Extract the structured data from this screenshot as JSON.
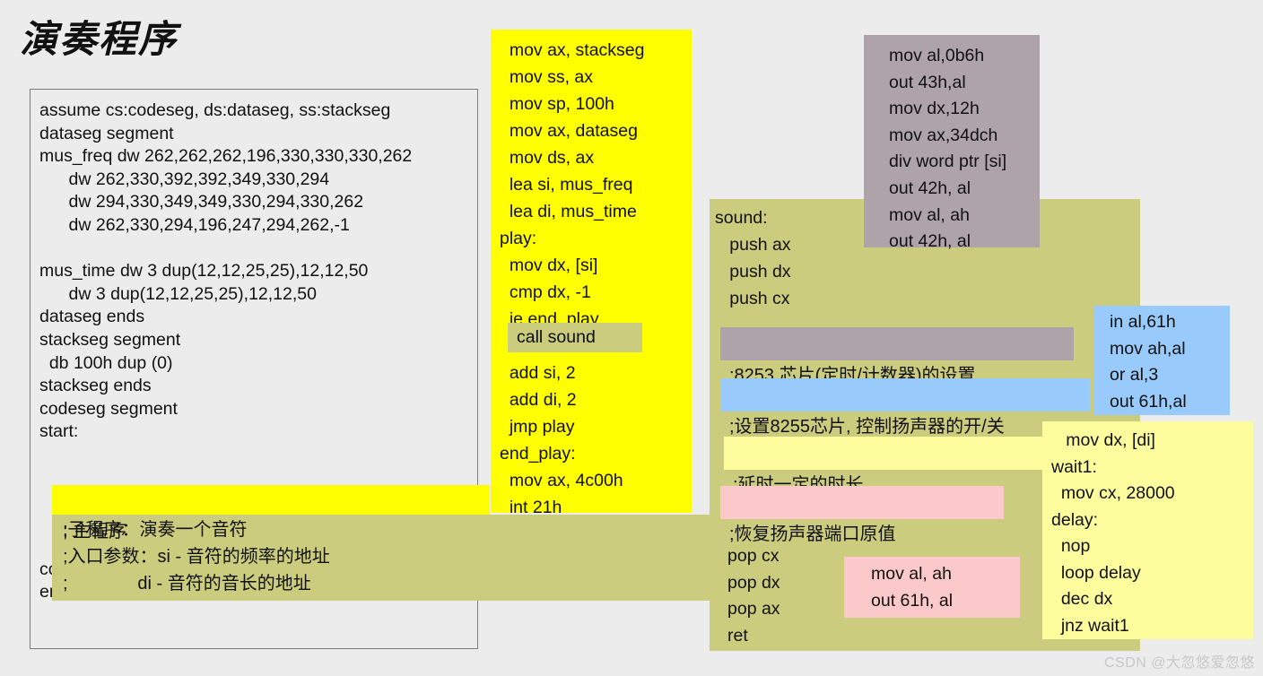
{
  "slide": {
    "title": "演奏程序",
    "watermark": "CSDN @大忽悠爱忽悠"
  },
  "colors": {
    "background": "#ececec",
    "yellow": "#ffff00",
    "light_yellow": "#fdfd9e",
    "olive": "#cbcc7e",
    "gray": "#aea3a8",
    "blue": "#98cbfb",
    "pink": "#fbc9c9",
    "box_border": "#7a7a7a",
    "text": "#0d0d0d"
  },
  "main_code_box": {
    "name": "程序框架",
    "lines": [
      "assume cs:codeseg, ds:dataseg, ss:stackseg",
      "dataseg segment",
      "mus_freq dw 262,262,262,196,330,330,330,262",
      "      dw 262,330,392,392,349,330,294",
      "      dw 294,330,349,349,330,294,330,262",
      "      dw 262,330,294,196,247,294,262,-1",
      "",
      "mus_time dw 3 dup(12,12,25,25),12,12,50",
      "      dw 3 dup(12,12,25,25),12,12,50",
      "dataseg ends",
      "stackseg segment",
      "  db 100h dup (0)",
      "stackseg ends",
      "codeseg segment",
      "start:",
      "",
      "",
      "",
      "",
      "",
      "codeseg ends",
      "end start"
    ]
  },
  "main_comment_bar": {
    "text": "; 主程序"
  },
  "sub_comment_bar": {
    "lines": [
      ";子程序：演奏一个音符",
      ";入口参数：si - 音符的频率的地址",
      ";              di - 音符的音长的地址"
    ]
  },
  "play_code_panel": {
    "lines": [
      "  mov ax, stackseg",
      "  mov ss, ax",
      "  mov sp, 100h",
      "  mov ax, dataseg",
      "  mov ds, ax",
      "  lea si, mus_freq",
      "  lea di, mus_time",
      "play:",
      "  mov dx, [si]",
      "  cmp dx, -1",
      "  je end_play",
      "  call sound",
      "  add si, 2",
      "  add di, 2",
      "  jmp play",
      "end_play:",
      "  mov ax, 4c00h",
      "  int 21h"
    ]
  },
  "call_sound_highlight": {
    "text": "call sound"
  },
  "timer_chip_panel": {
    "lines": [
      "mov al,0b6h",
      "out 43h,al",
      "mov dx,12h",
      "mov ax,34dch",
      "div word ptr [si]",
      "out 42h, al",
      "mov al, ah",
      "out 42h, al"
    ]
  },
  "sound_proc_head": {
    "lines": [
      "sound:",
      "   push ax",
      "   push dx",
      "   push cx"
    ]
  },
  "comment_8253": {
    "text": ";8253 芯片(定时/计数器)的设置"
  },
  "comment_8255": {
    "text": ";设置8255芯片, 控制扬声器的开/关"
  },
  "speaker_on_panel": {
    "lines": [
      "in al,61h",
      "mov ah,al",
      "or al,3",
      "out 61h,al"
    ]
  },
  "comment_delay": {
    "text": ";延时一定的时长"
  },
  "comment_restore": {
    "text": ";恢复扬声器端口原值"
  },
  "pop_panel": {
    "lines": [
      "pop cx",
      "pop dx",
      "pop ax",
      "ret"
    ]
  },
  "restore_code_panel": {
    "lines": [
      "mov al, ah",
      "out 61h, al"
    ]
  },
  "delay_code_panel": {
    "lines": [
      "   mov dx, [di]",
      "wait1:",
      "  mov cx, 28000",
      "delay:",
      "  nop",
      "  loop delay",
      "  dec dx",
      "  jnz wait1"
    ]
  }
}
